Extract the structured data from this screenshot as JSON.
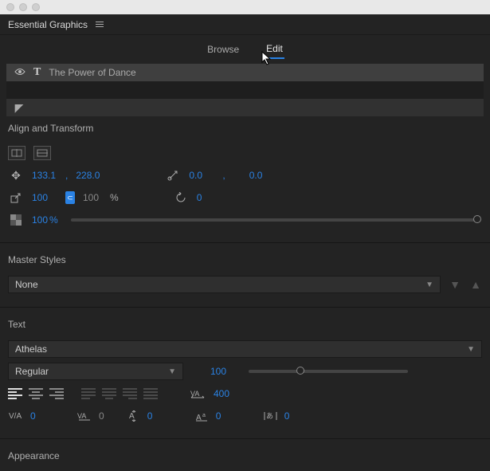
{
  "panel": {
    "title": "Essential Graphics"
  },
  "tabs": {
    "browse": "Browse",
    "edit": "Edit",
    "active": "edit"
  },
  "layer": {
    "name": "The Power of Dance",
    "type_glyph": "T"
  },
  "sections": {
    "align": "Align and Transform",
    "master": "Master Styles",
    "text": "Text",
    "appearance": "Appearance"
  },
  "transform": {
    "pos_x": "133.1",
    "pos_y": "228.0",
    "anchor_x": "0.0",
    "anchor_y": "0.0",
    "scale_w": "100",
    "scale_h": "100",
    "scale_unit": "%",
    "rotation": "0",
    "opacity": "100",
    "opacity_unit": "%"
  },
  "master_styles": {
    "selected": "None"
  },
  "text": {
    "font": "Athelas",
    "style": "Regular",
    "size": "100",
    "tracking": "400",
    "kerning": "0",
    "va": "0",
    "baseline": "0",
    "leading": "0",
    "tsume": "0"
  }
}
